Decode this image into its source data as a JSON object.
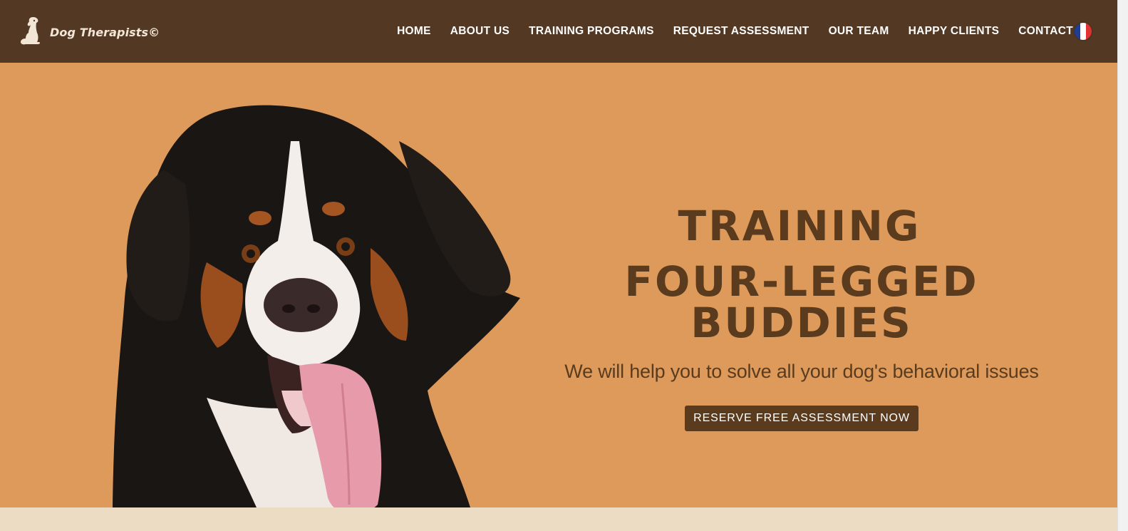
{
  "header": {
    "logo_text": "Dog Therapists©",
    "nav": [
      {
        "label": "HOME"
      },
      {
        "label": "ABOUT US"
      },
      {
        "label": "TRAINING PROGRAMS"
      },
      {
        "label": "REQUEST ASSESSMENT"
      },
      {
        "label": "OUR TEAM"
      },
      {
        "label": "HAPPY CLIENTS"
      },
      {
        "label": "CONTACT"
      }
    ],
    "language_flag": "france-flag-icon"
  },
  "hero": {
    "title_line_1": "TRAINING",
    "title_line_2": "FOUR-LEGGED BUDDIES",
    "subtitle": "We will help you to solve all your dog's behavioral issues",
    "cta_label": "RESERVE FREE ASSESSMENT NOW"
  },
  "colors": {
    "header_bg": "#533823",
    "hero_bg": "#dd9a5b",
    "text_brown": "#5a3b1d",
    "footer_bg": "#ecdcc4"
  }
}
